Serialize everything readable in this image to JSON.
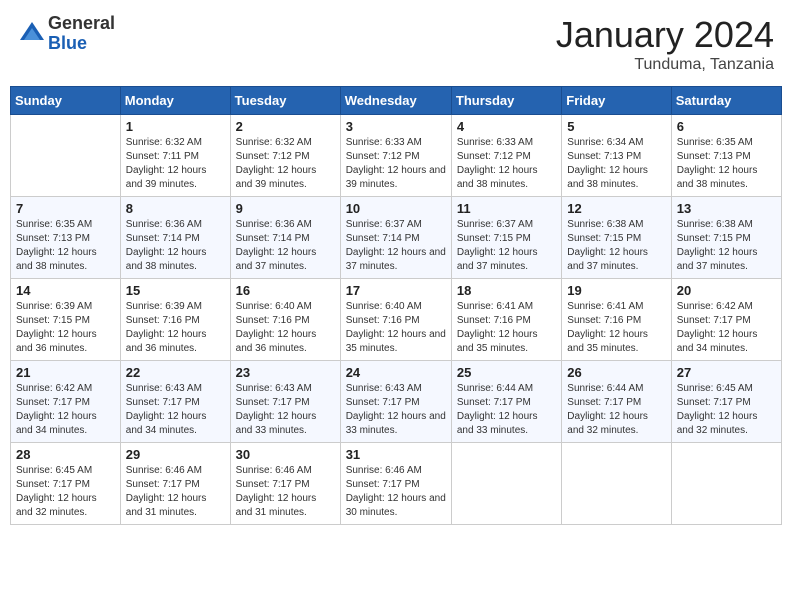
{
  "logo": {
    "general": "General",
    "blue": "Blue"
  },
  "title": {
    "month": "January 2024",
    "location": "Tunduma, Tanzania"
  },
  "weekdays": [
    "Sunday",
    "Monday",
    "Tuesday",
    "Wednesday",
    "Thursday",
    "Friday",
    "Saturday"
  ],
  "weeks": [
    [
      {
        "day": "",
        "sunrise": "",
        "sunset": "",
        "daylight": ""
      },
      {
        "day": "1",
        "sunrise": "Sunrise: 6:32 AM",
        "sunset": "Sunset: 7:11 PM",
        "daylight": "Daylight: 12 hours and 39 minutes."
      },
      {
        "day": "2",
        "sunrise": "Sunrise: 6:32 AM",
        "sunset": "Sunset: 7:12 PM",
        "daylight": "Daylight: 12 hours and 39 minutes."
      },
      {
        "day": "3",
        "sunrise": "Sunrise: 6:33 AM",
        "sunset": "Sunset: 7:12 PM",
        "daylight": "Daylight: 12 hours and 39 minutes."
      },
      {
        "day": "4",
        "sunrise": "Sunrise: 6:33 AM",
        "sunset": "Sunset: 7:12 PM",
        "daylight": "Daylight: 12 hours and 38 minutes."
      },
      {
        "day": "5",
        "sunrise": "Sunrise: 6:34 AM",
        "sunset": "Sunset: 7:13 PM",
        "daylight": "Daylight: 12 hours and 38 minutes."
      },
      {
        "day": "6",
        "sunrise": "Sunrise: 6:35 AM",
        "sunset": "Sunset: 7:13 PM",
        "daylight": "Daylight: 12 hours and 38 minutes."
      }
    ],
    [
      {
        "day": "7",
        "sunrise": "Sunrise: 6:35 AM",
        "sunset": "Sunset: 7:13 PM",
        "daylight": "Daylight: 12 hours and 38 minutes."
      },
      {
        "day": "8",
        "sunrise": "Sunrise: 6:36 AM",
        "sunset": "Sunset: 7:14 PM",
        "daylight": "Daylight: 12 hours and 38 minutes."
      },
      {
        "day": "9",
        "sunrise": "Sunrise: 6:36 AM",
        "sunset": "Sunset: 7:14 PM",
        "daylight": "Daylight: 12 hours and 37 minutes."
      },
      {
        "day": "10",
        "sunrise": "Sunrise: 6:37 AM",
        "sunset": "Sunset: 7:14 PM",
        "daylight": "Daylight: 12 hours and 37 minutes."
      },
      {
        "day": "11",
        "sunrise": "Sunrise: 6:37 AM",
        "sunset": "Sunset: 7:15 PM",
        "daylight": "Daylight: 12 hours and 37 minutes."
      },
      {
        "day": "12",
        "sunrise": "Sunrise: 6:38 AM",
        "sunset": "Sunset: 7:15 PM",
        "daylight": "Daylight: 12 hours and 37 minutes."
      },
      {
        "day": "13",
        "sunrise": "Sunrise: 6:38 AM",
        "sunset": "Sunset: 7:15 PM",
        "daylight": "Daylight: 12 hours and 37 minutes."
      }
    ],
    [
      {
        "day": "14",
        "sunrise": "Sunrise: 6:39 AM",
        "sunset": "Sunset: 7:15 PM",
        "daylight": "Daylight: 12 hours and 36 minutes."
      },
      {
        "day": "15",
        "sunrise": "Sunrise: 6:39 AM",
        "sunset": "Sunset: 7:16 PM",
        "daylight": "Daylight: 12 hours and 36 minutes."
      },
      {
        "day": "16",
        "sunrise": "Sunrise: 6:40 AM",
        "sunset": "Sunset: 7:16 PM",
        "daylight": "Daylight: 12 hours and 36 minutes."
      },
      {
        "day": "17",
        "sunrise": "Sunrise: 6:40 AM",
        "sunset": "Sunset: 7:16 PM",
        "daylight": "Daylight: 12 hours and 35 minutes."
      },
      {
        "day": "18",
        "sunrise": "Sunrise: 6:41 AM",
        "sunset": "Sunset: 7:16 PM",
        "daylight": "Daylight: 12 hours and 35 minutes."
      },
      {
        "day": "19",
        "sunrise": "Sunrise: 6:41 AM",
        "sunset": "Sunset: 7:16 PM",
        "daylight": "Daylight: 12 hours and 35 minutes."
      },
      {
        "day": "20",
        "sunrise": "Sunrise: 6:42 AM",
        "sunset": "Sunset: 7:17 PM",
        "daylight": "Daylight: 12 hours and 34 minutes."
      }
    ],
    [
      {
        "day": "21",
        "sunrise": "Sunrise: 6:42 AM",
        "sunset": "Sunset: 7:17 PM",
        "daylight": "Daylight: 12 hours and 34 minutes."
      },
      {
        "day": "22",
        "sunrise": "Sunrise: 6:43 AM",
        "sunset": "Sunset: 7:17 PM",
        "daylight": "Daylight: 12 hours and 34 minutes."
      },
      {
        "day": "23",
        "sunrise": "Sunrise: 6:43 AM",
        "sunset": "Sunset: 7:17 PM",
        "daylight": "Daylight: 12 hours and 33 minutes."
      },
      {
        "day": "24",
        "sunrise": "Sunrise: 6:43 AM",
        "sunset": "Sunset: 7:17 PM",
        "daylight": "Daylight: 12 hours and 33 minutes."
      },
      {
        "day": "25",
        "sunrise": "Sunrise: 6:44 AM",
        "sunset": "Sunset: 7:17 PM",
        "daylight": "Daylight: 12 hours and 33 minutes."
      },
      {
        "day": "26",
        "sunrise": "Sunrise: 6:44 AM",
        "sunset": "Sunset: 7:17 PM",
        "daylight": "Daylight: 12 hours and 32 minutes."
      },
      {
        "day": "27",
        "sunrise": "Sunrise: 6:45 AM",
        "sunset": "Sunset: 7:17 PM",
        "daylight": "Daylight: 12 hours and 32 minutes."
      }
    ],
    [
      {
        "day": "28",
        "sunrise": "Sunrise: 6:45 AM",
        "sunset": "Sunset: 7:17 PM",
        "daylight": "Daylight: 12 hours and 32 minutes."
      },
      {
        "day": "29",
        "sunrise": "Sunrise: 6:46 AM",
        "sunset": "Sunset: 7:17 PM",
        "daylight": "Daylight: 12 hours and 31 minutes."
      },
      {
        "day": "30",
        "sunrise": "Sunrise: 6:46 AM",
        "sunset": "Sunset: 7:17 PM",
        "daylight": "Daylight: 12 hours and 31 minutes."
      },
      {
        "day": "31",
        "sunrise": "Sunrise: 6:46 AM",
        "sunset": "Sunset: 7:17 PM",
        "daylight": "Daylight: 12 hours and 30 minutes."
      },
      {
        "day": "",
        "sunrise": "",
        "sunset": "",
        "daylight": ""
      },
      {
        "day": "",
        "sunrise": "",
        "sunset": "",
        "daylight": ""
      },
      {
        "day": "",
        "sunrise": "",
        "sunset": "",
        "daylight": ""
      }
    ]
  ]
}
